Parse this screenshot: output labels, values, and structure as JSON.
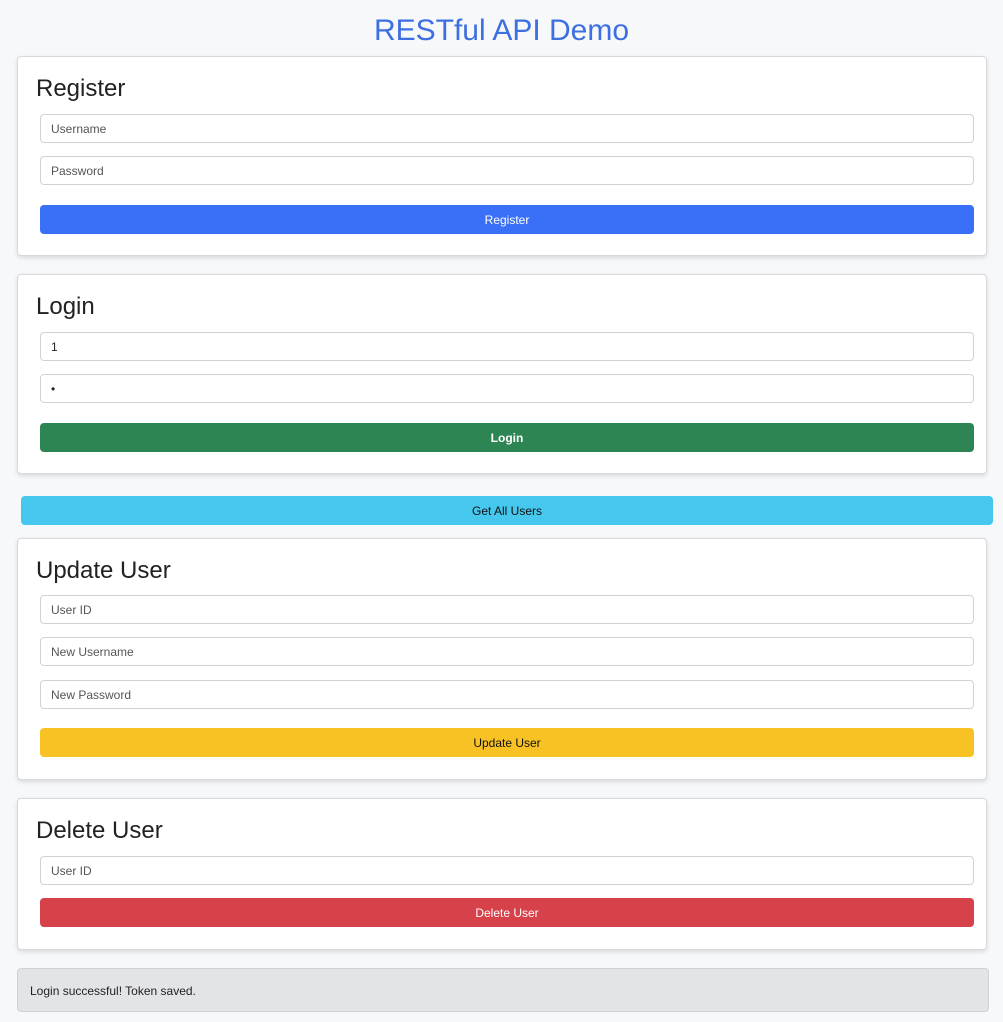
{
  "page": {
    "title": "RESTful API Demo"
  },
  "register": {
    "heading": "Register",
    "username_placeholder": "Username",
    "password_placeholder": "Password",
    "button_label": "Register"
  },
  "login": {
    "heading": "Login",
    "username_value": "1",
    "password_value": "1",
    "button_label": "Login"
  },
  "get_all_users": {
    "button_label": "Get All Users"
  },
  "update_user": {
    "heading": "Update User",
    "user_id_placeholder": "User ID",
    "new_username_placeholder": "New Username",
    "new_password_placeholder": "New Password",
    "button_label": "Update User"
  },
  "delete_user": {
    "heading": "Delete User",
    "user_id_placeholder": "User ID",
    "button_label": "Delete User"
  },
  "status": {
    "message": "Login successful! Token saved."
  },
  "colors": {
    "title": "#3d6fe0",
    "register_button": "#3a6ff7",
    "login_button": "#2d8554",
    "get_all_users_button": "#46c7ee",
    "update_button": "#f8c224",
    "delete_button": "#d6414a"
  }
}
